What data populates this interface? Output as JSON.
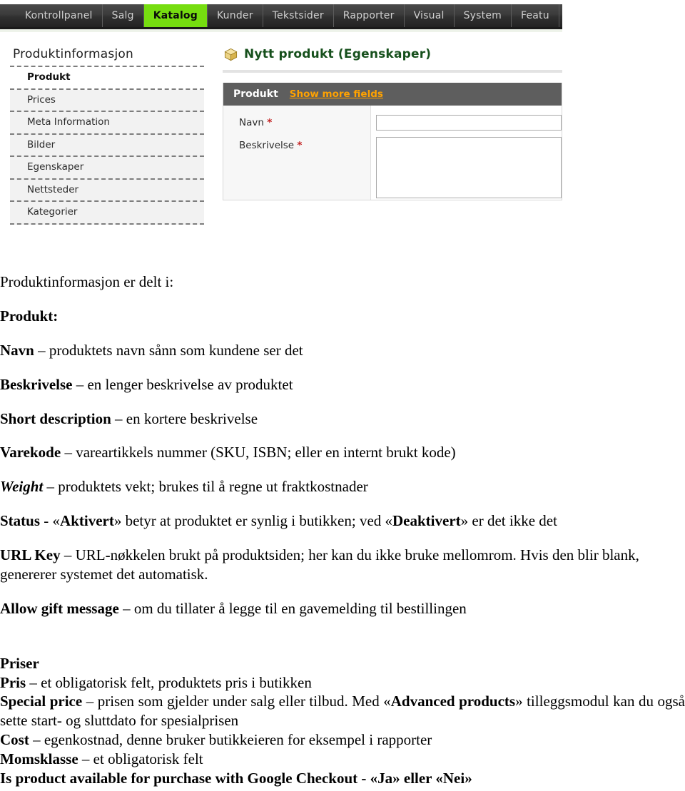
{
  "screenshot": {
    "navbar": {
      "tabs": [
        {
          "label": "Kontrollpanel",
          "active": false
        },
        {
          "label": "Salg",
          "active": false
        },
        {
          "label": "Katalog",
          "active": true
        },
        {
          "label": "Kunder",
          "active": false
        },
        {
          "label": "Tekstsider",
          "active": false
        },
        {
          "label": "Rapporter",
          "active": false
        },
        {
          "label": "Visual",
          "active": false
        },
        {
          "label": "System",
          "active": false
        },
        {
          "label": "Featu",
          "active": false
        }
      ],
      "active_tab_color": "#76DD10",
      "background_color": "#3b3b3b"
    },
    "sidebar": {
      "title": "Produktinformasjon",
      "items": [
        {
          "label": "Produkt",
          "active": true
        },
        {
          "label": "Prices",
          "active": false
        },
        {
          "label": "Meta Information",
          "active": false
        },
        {
          "label": "Bilder",
          "active": false
        },
        {
          "label": "Egenskaper",
          "active": false
        },
        {
          "label": "Nettsteder",
          "active": false
        },
        {
          "label": "Kategorier",
          "active": false
        }
      ]
    },
    "panel": {
      "heading": "Nytt produkt (Egenskaper)",
      "heading_color": "#16501c",
      "icon": "cube-icon",
      "form": {
        "header_title": "Produkt",
        "header_link": "Show more fields",
        "header_link_color": "#ffa200",
        "header_background": "#5e5e5e",
        "fields": [
          {
            "label": "Navn",
            "required_marker": "*",
            "value": "",
            "type": "text"
          },
          {
            "label": "Beskrivelse",
            "required_marker": "*",
            "value": "",
            "type": "textarea"
          }
        ]
      }
    }
  },
  "document": {
    "intro": "Produktinformasjon er delt i:",
    "section_produkt_heading": "Produkt:",
    "items": [
      {
        "term": "Navn",
        "term_style": "bold",
        "rest": " – produktets navn sånn som kundene ser det"
      },
      {
        "term": "Beskrivelse",
        "term_style": "bold",
        "rest": " – en lenger beskrivelse av produktet"
      },
      {
        "term": "Short description",
        "term_style": "bold",
        "rest": " – en kortere beskrivelse"
      },
      {
        "term": "Varekode",
        "term_style": "bold",
        "rest": " – vareartikkels nummer (SKU, ISBN; eller en internt brukt kode)"
      },
      {
        "term": "Weight",
        "term_style": "bold-italic",
        "rest": " – produktets vekt; brukes til å regne ut fraktkostnader"
      }
    ],
    "status_line": {
      "term": "Status",
      "part1": " - «",
      "emph1": "Aktivert",
      "part2": "» betyr at produktet er synlig i butikken; ved «",
      "emph2": "Deaktivert",
      "part3": "» er det ikke det"
    },
    "urlkey_line": {
      "term": "URL Key",
      "rest": " – URL-nøkkelen brukt på produktsiden; her kan du ikke bruke mellomrom. Hvis den blir blank, genererer systemet det automatisk."
    },
    "giftmessage_line": {
      "term": "Allow gift message",
      "rest": " – om du tillater å legge til en gavemelding til bestillingen"
    },
    "section_priser_heading": "Priser",
    "price_items": [
      {
        "term": "Pris",
        "rest": " – et obligatorisk felt, produktets pris i butikken"
      }
    ],
    "special_price_line": {
      "term": "Special price",
      "part1": " – prisen som gjelder under salg eller tilbud. Med «",
      "emph1": "Advanced products",
      "part2": "» tilleggsmodul kan du også sette start- og sluttdato for spesialprisen"
    },
    "cost_line": {
      "term": "Cost",
      "rest": " – egenkostnad, denne bruker butikkeieren for eksempel i rapporter"
    },
    "momsklasse_line": {
      "term": "Momsklasse",
      "rest": " – et obligatorisk felt"
    },
    "google_checkout_line": {
      "term": "Is product available for purchase with Google Checkout",
      "rest": "  - «Ja» eller «Nei»"
    }
  }
}
